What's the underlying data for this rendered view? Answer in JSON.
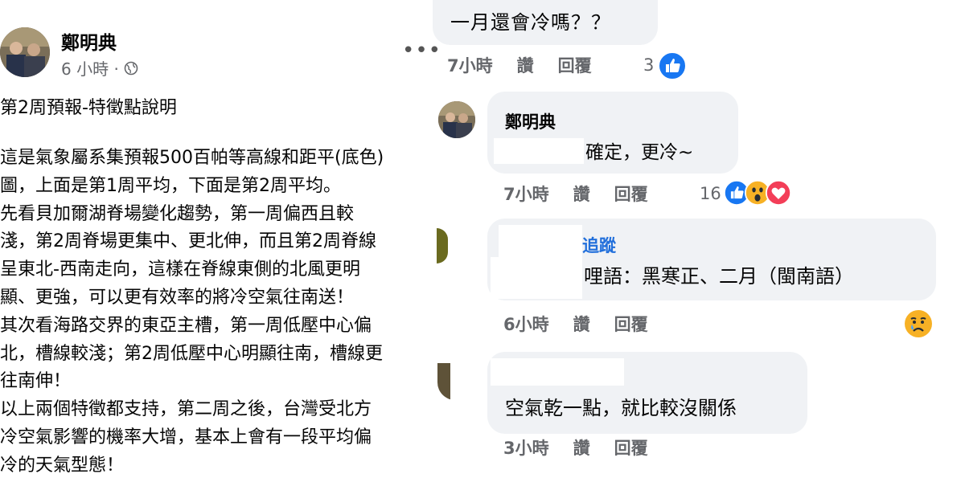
{
  "post": {
    "author": "鄭明典",
    "time": "6 小時 ·",
    "title": "第2周預報-特徵點說明",
    "body_lines": [
      "這是氣象屬系集預報500百帕等高線和距平(底色)",
      "圖，上面是第1周平均，下面是第2周平均。",
      "先看貝加爾湖脊場變化趨勢，第一周偏西且較",
      "淺，第2周脊場更集中、更北伸，而且第2周脊線",
      "呈東北-西南走向，這樣在脊線東側的北風更明",
      "顯、更強，可以更有效率的將冷空氣往南送！",
      "其次看海路交界的東亞主槽，第一周低壓中心偏",
      "北，槽線較淺；第2周低壓中心明顯往南，槽線更",
      "往南伸！",
      "以上兩個特徵都支持，第二周之後，台灣受北方",
      "冷空氣影響的機率大增，基本上會有一段平均偏",
      "冷的天氣型態！"
    ],
    "more_icon": "more-dots-icon",
    "privacy_icon": "globe-icon"
  },
  "comments": [
    {
      "text": "一月還會冷嗎？？",
      "time": "7小時",
      "like_label": "讚",
      "reply_label": "回覆",
      "reaction_count": "3",
      "reactions": [
        "like-icon"
      ]
    },
    {
      "author": "鄭明典",
      "text": "確定，更冷~",
      "time": "7小時",
      "like_label": "讚",
      "reply_label": "回覆",
      "reaction_count": "16",
      "reactions": [
        "like-icon",
        "wow-icon",
        "love-icon"
      ]
    },
    {
      "follow_label": "追蹤",
      "text": "哩語：黑寒正、二月（閩南語）",
      "time": "6小時",
      "like_label": "讚",
      "reply_label": "回覆",
      "reactions": [
        "sad-icon"
      ]
    },
    {
      "text": "空氣乾一點，就比較沒關係",
      "time": "3小時",
      "like_label": "讚",
      "reply_label": "回覆"
    }
  ],
  "colors": {
    "bubble": "#f0f2f5",
    "meta_text": "#65676b",
    "link_blue": "#216fdb",
    "like_blue": "#1877f2",
    "love_red": "#f33e58",
    "wow_yellow": "#f7b125"
  }
}
